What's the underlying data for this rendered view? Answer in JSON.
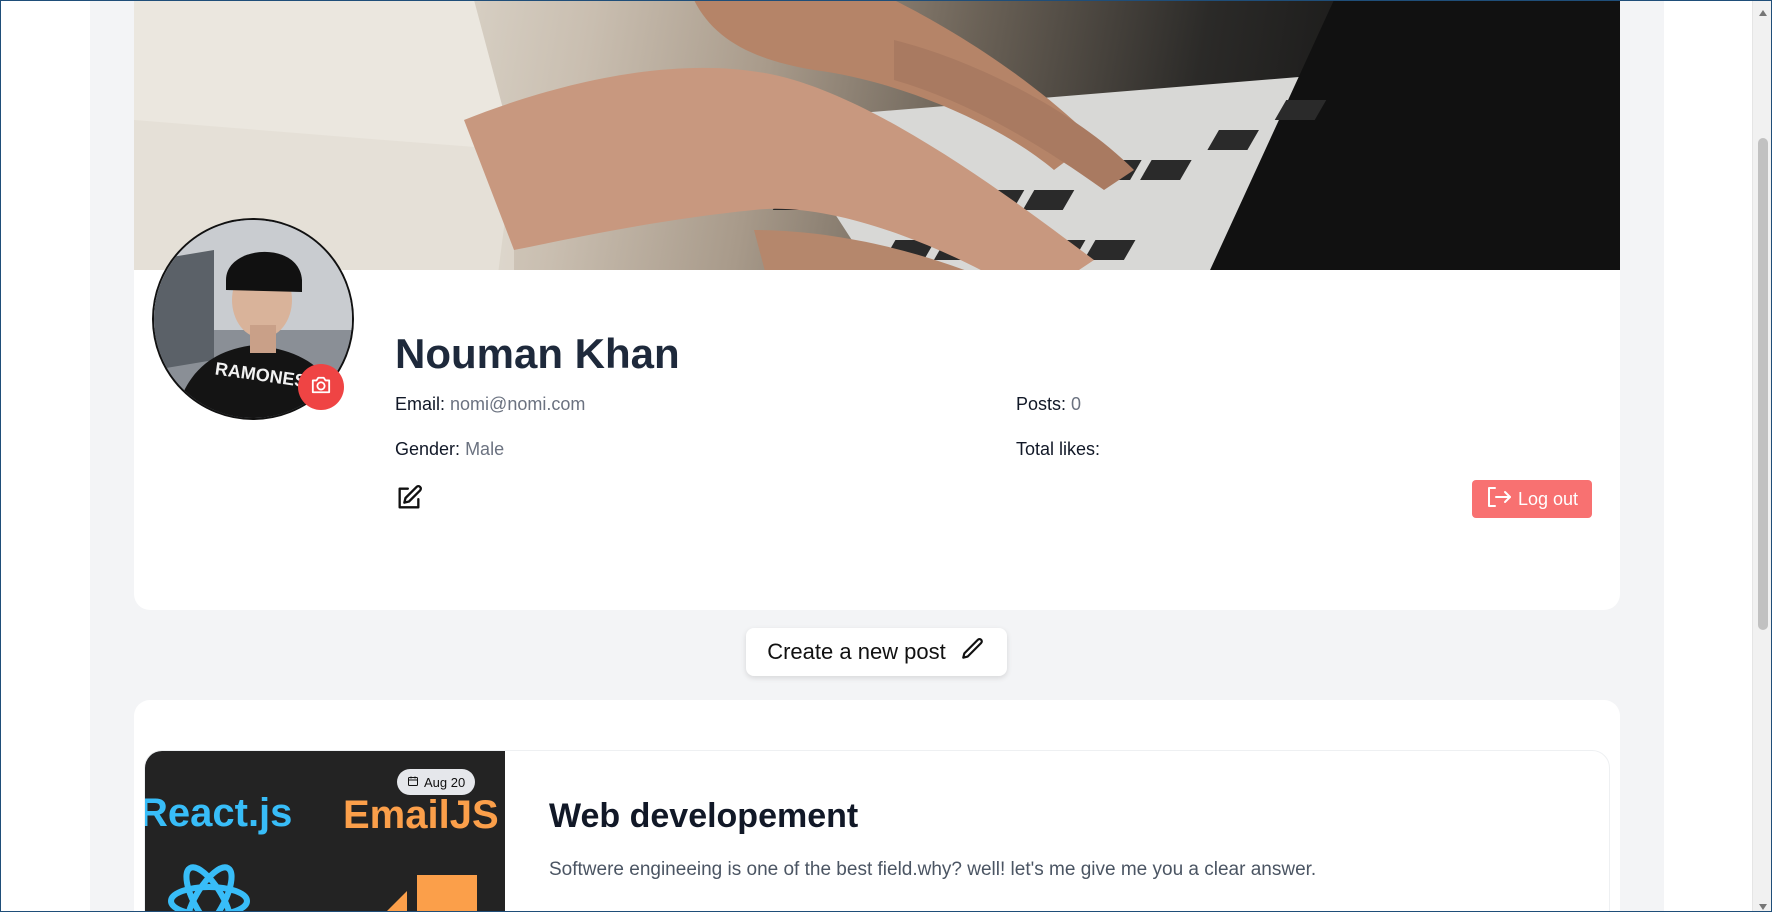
{
  "profile": {
    "name": "Nouman Khan",
    "email_label": "Email:",
    "email_value": "nomi@nomi.com",
    "gender_label": "Gender:",
    "gender_value": "Male",
    "posts_label": "Posts:",
    "posts_value": "0",
    "likes_label": "Total likes:",
    "likes_value": "",
    "logout_label": "Log out"
  },
  "actions": {
    "create_post_label": "Create a new post"
  },
  "posts": [
    {
      "date": "Aug 20",
      "title": "Web developement",
      "excerpt": "Softwere engineeing is one of the best field.why? well! let's me give me you a clear answer.",
      "thumb_text_left": "React.js",
      "thumb_text_right": "EmailJS"
    }
  ],
  "avatar": {
    "shirt_text": "RAMONES"
  },
  "colors": {
    "accent_red": "#ef4444",
    "logout_bg": "#f87171",
    "page_bg": "#f3f4f6"
  },
  "icons": {
    "camera": "camera-icon",
    "edit": "edit-icon",
    "logout": "logout-icon",
    "pencil": "pencil-icon",
    "calendar": "calendar-icon"
  }
}
